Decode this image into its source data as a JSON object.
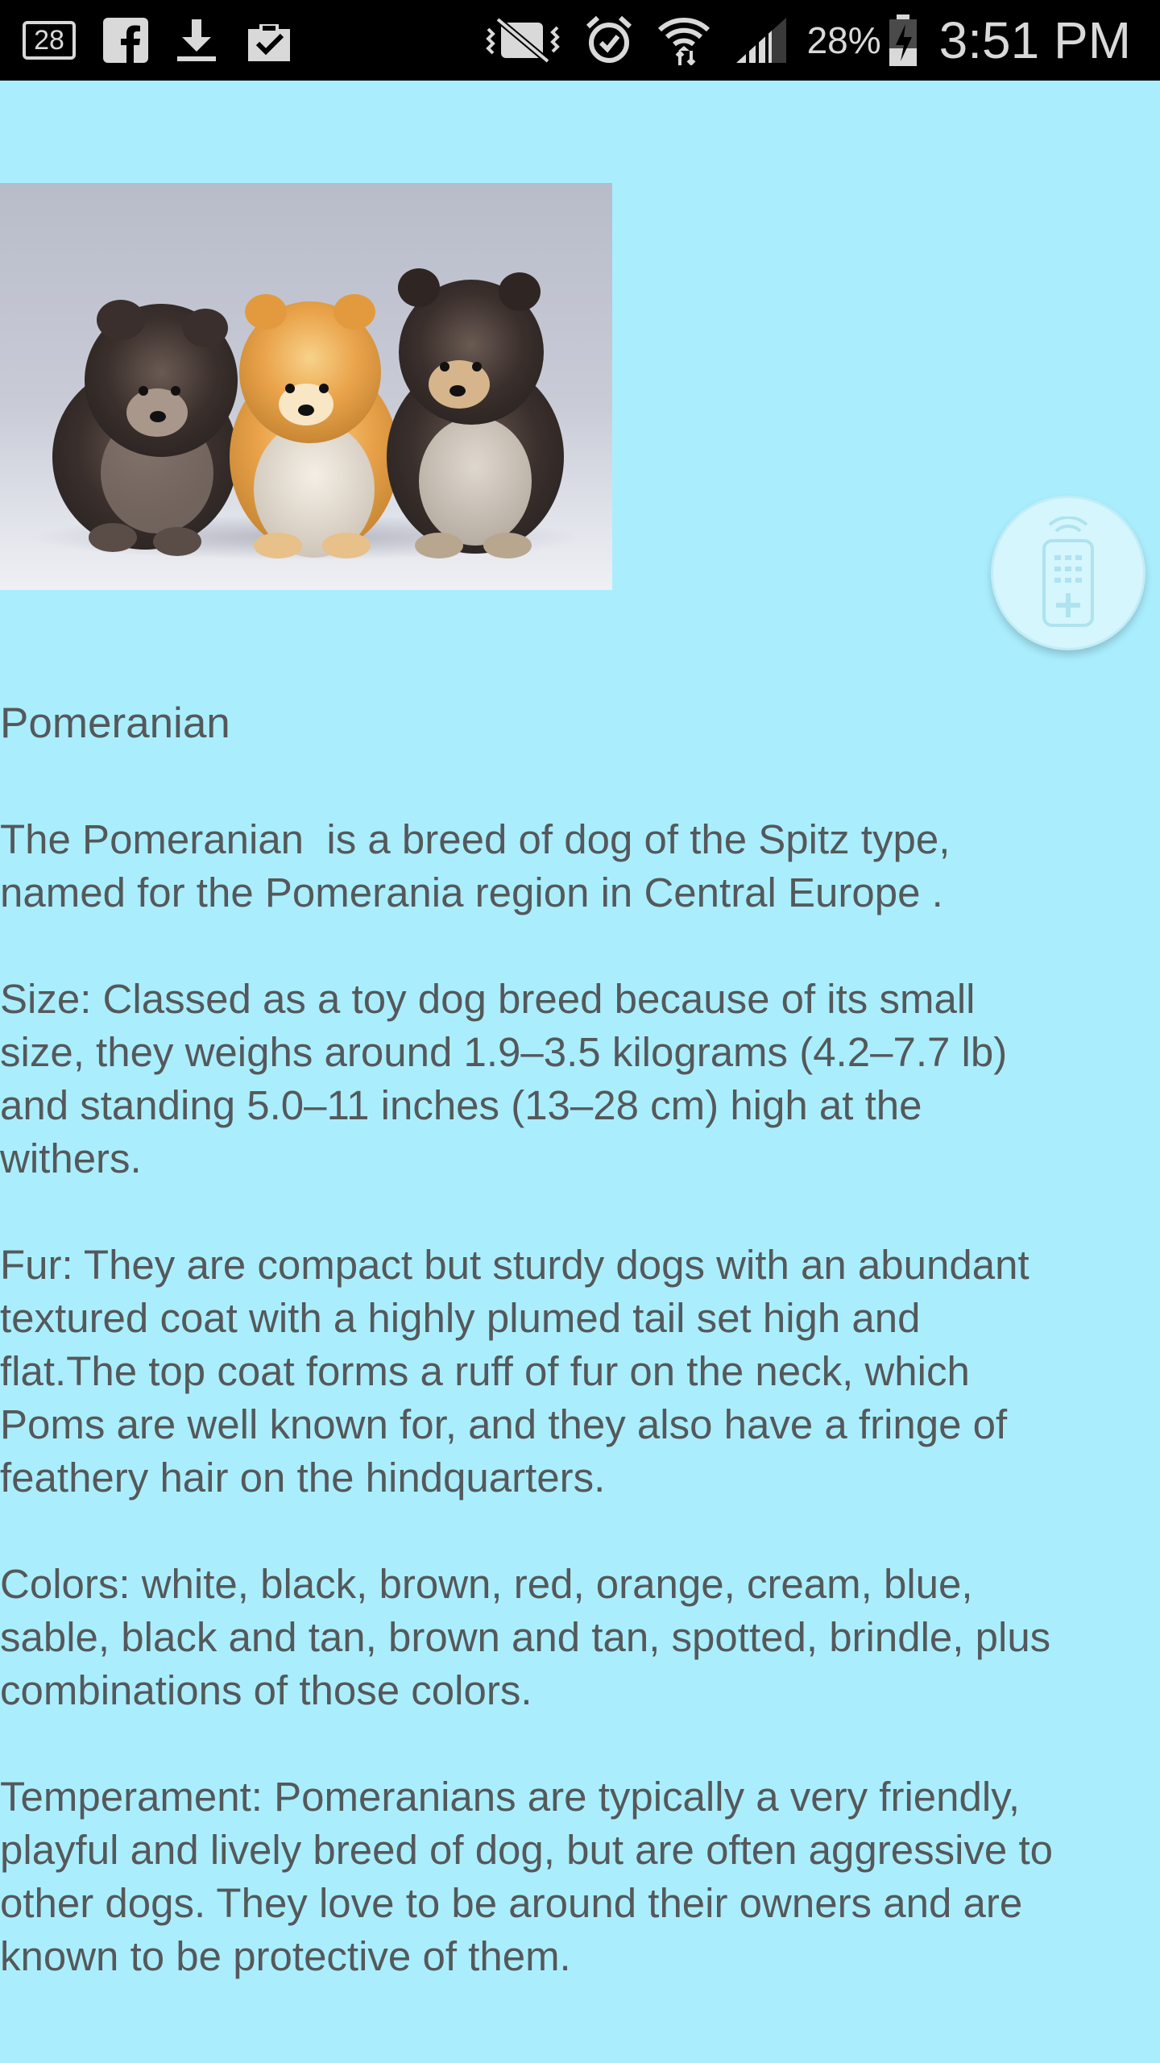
{
  "status_bar": {
    "notification_count": "28",
    "battery_percent": "28%",
    "time": "3:51 PM",
    "left_icons": [
      "notification-count-icon",
      "facebook-icon",
      "download-icon",
      "clipboard-check-icon"
    ],
    "right_icons": [
      "vibrate-mute-icon",
      "alarm-icon",
      "wifi-icon",
      "signal-icon",
      "battery-charging-icon"
    ]
  },
  "content": {
    "image_icon": "pomeranian-puppies-photo",
    "remote_button_icon": "remote-control-icon",
    "title": "Pomeranian",
    "paragraphs": [
      "The Pomeranian  is a breed of dog of the Spitz type,\nnamed for the Pomerania region in Central Europe .",
      "Size: Classed as a toy dog breed because of its small\nsize, they weighs around 1.9–3.5 kilograms (4.2–7.7 lb)\nand standing 5.0–11 inches (13–28 cm) high at the\nwithers.",
      "Fur: They are compact but sturdy dogs with an abundant\ntextured coat with a highly plumed tail set high and\nflat.The top coat forms a ruff of fur on the neck, which\nPoms are well known for, and they also have a fringe of\nfeathery hair on the hindquarters.",
      "Colors: white, black, brown, red, orange, cream, blue,\nsable, black and tan, brown and tan, spotted, brindle, plus\ncombinations of those colors.",
      "Temperament: Pomeranians are typically a very friendly,\nplayful and lively breed of dog, but are often aggressive to\nother dogs. They love to be around their owners and are\nknown to be protective of them."
    ]
  },
  "colors": {
    "background": "#aaeefe",
    "text": "#55585a",
    "status_bar": "#000000"
  }
}
